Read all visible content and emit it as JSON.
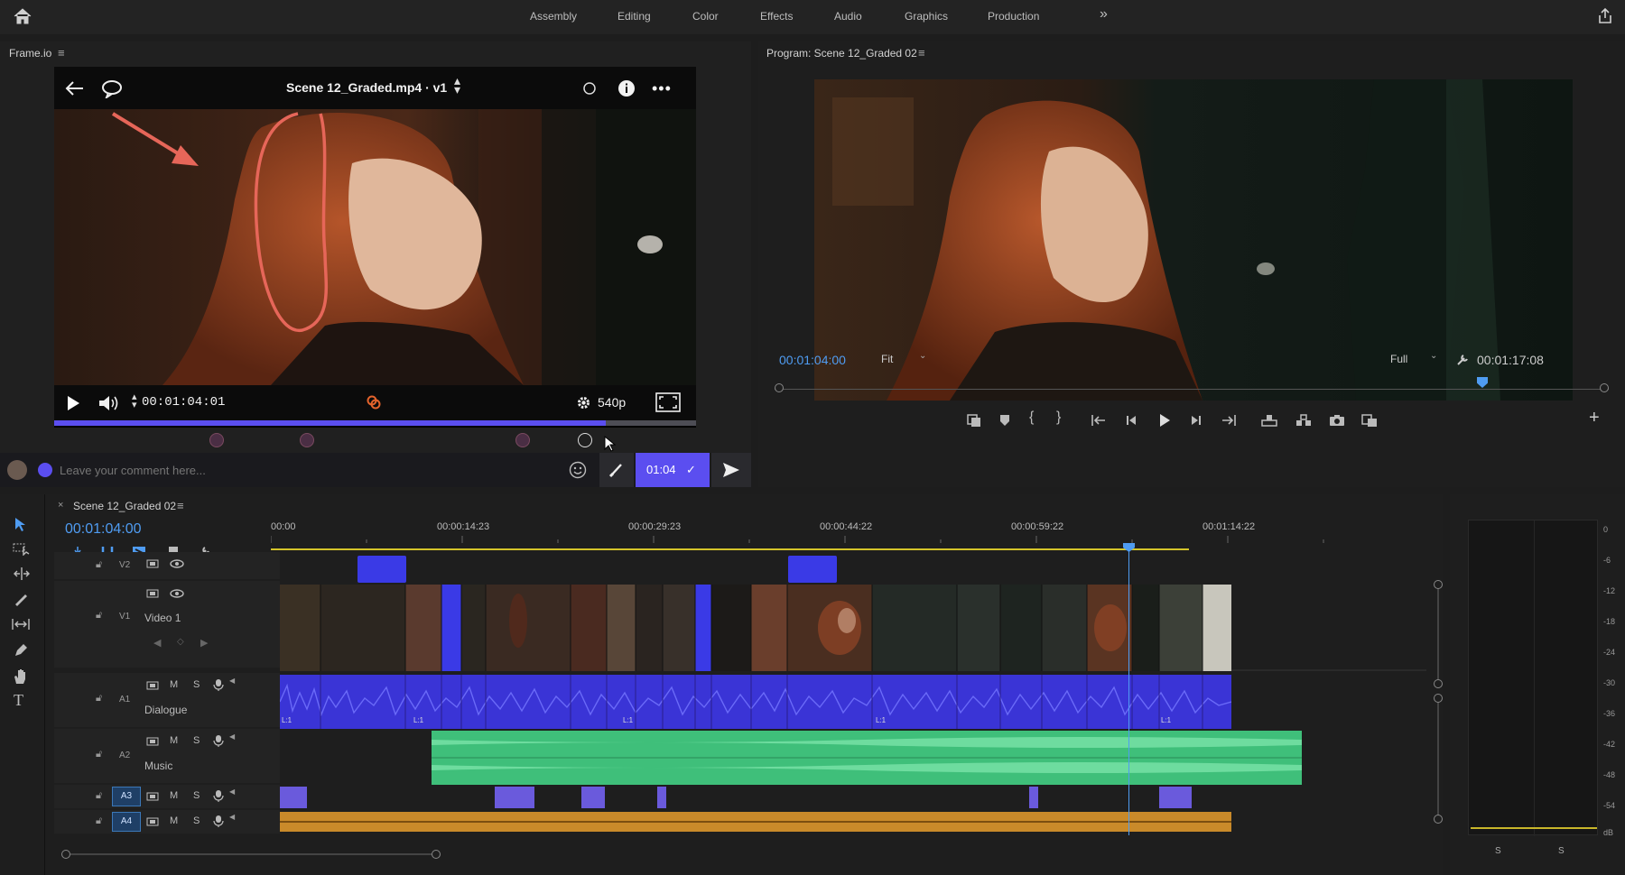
{
  "topbar": {
    "workspaces": [
      "Assembly",
      "Editing",
      "Color",
      "Effects",
      "Audio",
      "Graphics",
      "Production"
    ],
    "more": "»"
  },
  "frameio": {
    "panel_title": "Frame.io",
    "file_title": "Scene 12_Graded.mp4 · v1",
    "timecode": "00:01:04:01",
    "quality": "540p",
    "progress": 0.86,
    "comment_placeholder": "Leave your comment here...",
    "comment_time": "01:04"
  },
  "program": {
    "panel_title": "Program: Scene 12_Graded 02",
    "timecode": "00:01:04:00",
    "fit": "Fit",
    "resolution": "Full",
    "duration": "00:01:17:08"
  },
  "timeline": {
    "sequence_name": "Scene 12_Graded 02",
    "timecode": "00:01:04:00",
    "ruler": [
      "00:00",
      "00:00:14:23",
      "00:00:29:23",
      "00:00:44:22",
      "00:00:59:22",
      "00:01:14:22"
    ],
    "tracks": {
      "v2": "V2",
      "v1": "V1",
      "v1_name": "Video 1",
      "a1": "A1",
      "a1_name": "Dialogue",
      "a2": "A2",
      "a2_name": "Music",
      "a3": "A3",
      "a4": "A4"
    },
    "track_buttons": {
      "m": "M",
      "s": "S"
    },
    "clip_label": "L:1"
  },
  "meter": {
    "scale": [
      "0",
      "-6",
      "-12",
      "-18",
      "-24",
      "-30",
      "-36",
      "-42",
      "-48",
      "-54",
      "dB"
    ],
    "solo": [
      "S",
      "S"
    ]
  },
  "colors": {
    "accent": "#5b4ef0",
    "program_blue": "#4f9cf2",
    "dialogue": "#3a34d6",
    "music": "#3fbf7a",
    "a4": "#c98a2a"
  }
}
